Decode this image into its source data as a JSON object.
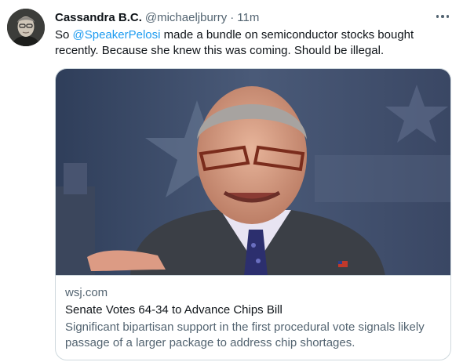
{
  "tweet": {
    "author": {
      "display_name": "Cassandra B.C.",
      "handle": "@michaeljburry",
      "separator": "·",
      "timestamp": "11m",
      "avatar_icon": "user-avatar"
    },
    "more_icon": "more-horizontal-icon",
    "text_before": "So ",
    "mention": "@SpeakerPelosi",
    "text_after": " made a bundle on semiconductor stocks bought recently. Because she knew this was coming. Should be illegal.",
    "link_card": {
      "image_icon": "news-photo",
      "domain": "wsj.com",
      "title": "Senate Votes 64-34 to Advance Chips Bill",
      "description": "Significant bipartisan support in the first procedural vote signals likely passage of a larger package to address chip shortages."
    }
  },
  "colors": {
    "accent": "#1d9bf0",
    "text_primary": "#0f1419",
    "text_secondary": "#536471",
    "border": "#cfd9de"
  }
}
